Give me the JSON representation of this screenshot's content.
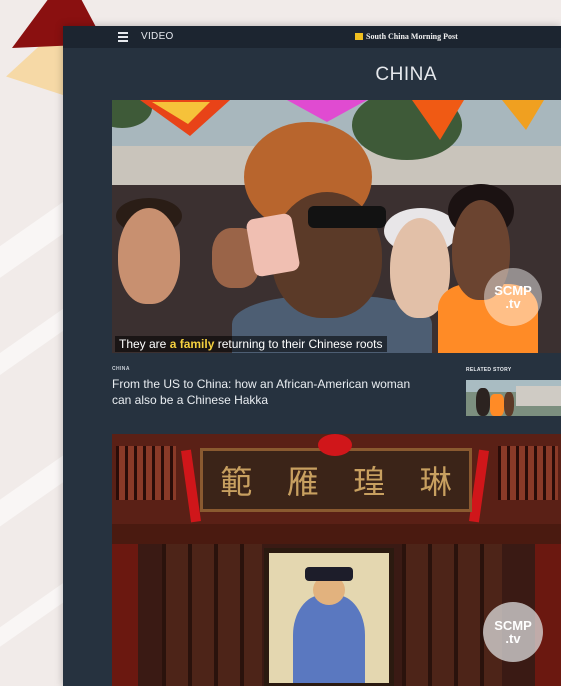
{
  "topbar": {
    "menu_icon": "hamburger-menu-icon",
    "nav_label": "VIDEO",
    "brand": "South China Morning Post"
  },
  "section": {
    "title": "CHINA"
  },
  "hero": {
    "caption_before": "They are ",
    "caption_highlight": "a family",
    "caption_after": " returning to their Chinese roots",
    "badge_line1": "SCMP",
    "badge_line2": ".tv"
  },
  "story": {
    "category": "CHINA",
    "title": "From the US to China: how an African-American woman can also be a Chinese Hakka"
  },
  "related": {
    "label": "RELATED STORY"
  },
  "second_video": {
    "plaque_chars": [
      "範",
      "雁",
      "瑝",
      "琳"
    ],
    "badge_line1": "SCMP",
    "badge_line2": ".tv"
  },
  "colors": {
    "page_bg": "#f1ebe9",
    "window_bg": "#26323f",
    "topbar_bg": "#1c2530",
    "accent_dark_red": "#8a1010",
    "accent_pale_yellow": "#f6d9a6",
    "caption_highlight": "#f4d03f"
  }
}
